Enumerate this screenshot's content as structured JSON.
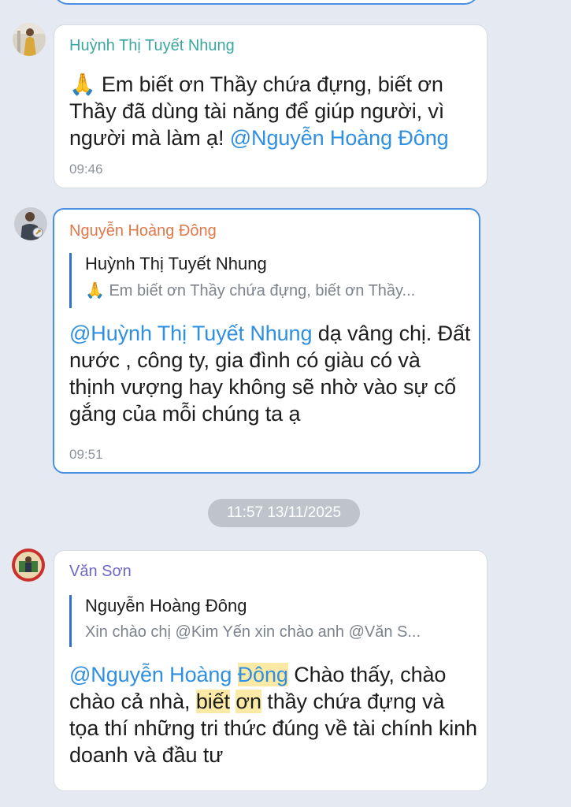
{
  "messages": [
    {
      "sender": "Huỳnh Thị Tuyết Nhung",
      "emoji": "🙏",
      "text_before": " Em biết ơn Thầy chứa đựng, biết ơn Thầy đã dùng tài năng để giúp người, vì người mà làm ạ! ",
      "mention": "@Nguyễn Hoàng Đông",
      "time": "09:46"
    },
    {
      "sender": "Nguyễn Hoàng Đông",
      "quote_name": "Huỳnh Thị Tuyết Nhung",
      "quote_text": "🙏 Em biết ơn Thầy chứa đựng, biết ơn Thầy...",
      "mention": "@Huỳnh Thị Tuyết Nhung",
      "text_after": " dạ vâng chị. Đất nước , công ty, gia đình có giàu có và thịnh vượng hay không sẽ nhờ vào sự cố gắng của mỗi chúng ta ạ",
      "time": "09:51"
    },
    {
      "sender": "Văn Sơn",
      "quote_name": "Nguyễn Hoàng Đông",
      "quote_text": "Xin chào chị @Kim Yến  xin chào anh @Văn S...",
      "mention_a": "@Nguyễn Hoàng ",
      "mention_hl": "Đông",
      "text_1": " Chào thấy, chào chào cả nhà, ",
      "hl_1": "biết",
      "space": " ",
      "hl_2": "ơn",
      "text_2": " thầy chứa đựng và tọa thí những tri thức đúng về tài chính kinh doanh và đầu tư"
    }
  ],
  "date_separator": "11:57 13/11/2025",
  "colors": {
    "background": "#e5e9f2",
    "mention": "#2f8fe0",
    "selected_border": "#4a90e2",
    "highlight": "#fbeaa6"
  }
}
